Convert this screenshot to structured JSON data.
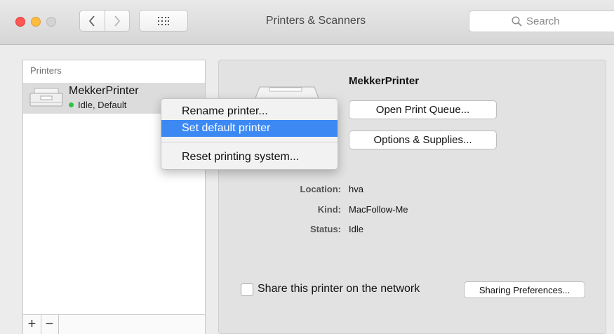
{
  "window": {
    "title": "Printers & Scanners"
  },
  "search": {
    "placeholder": "Search"
  },
  "printers_list": {
    "header": "Printers",
    "items": [
      {
        "name": "MekkerPrinter",
        "status": "Idle, Default"
      }
    ],
    "add_label": "+",
    "remove_label": "−"
  },
  "context_menu": {
    "items": [
      {
        "label": "Rename printer..."
      },
      {
        "label": "Set default printer"
      },
      {
        "label": "Reset printing system..."
      }
    ]
  },
  "detail": {
    "title": "MekkerPrinter",
    "open_queue_label": "Open Print Queue...",
    "options_label": "Options & Supplies...",
    "location_label": "Location:",
    "location_value": "hva",
    "kind_label": "Kind:",
    "kind_value": "MacFollow-Me",
    "status_label": "Status:",
    "status_value": "Idle",
    "share_label": "Share this printer on the network",
    "sharing_prefs_label": "Sharing Preferences..."
  },
  "colors": {
    "close": "#fc5753",
    "minimize": "#fdbc40",
    "zoom": "#d3d3d3",
    "menu_highlight": "#3c89f4",
    "status_green": "#2ec24a"
  },
  "icons": {
    "back": "chevron-left-icon",
    "forward": "chevron-right-icon",
    "grid": "grid-icon",
    "search": "search-icon",
    "printer": "printer-icon"
  }
}
